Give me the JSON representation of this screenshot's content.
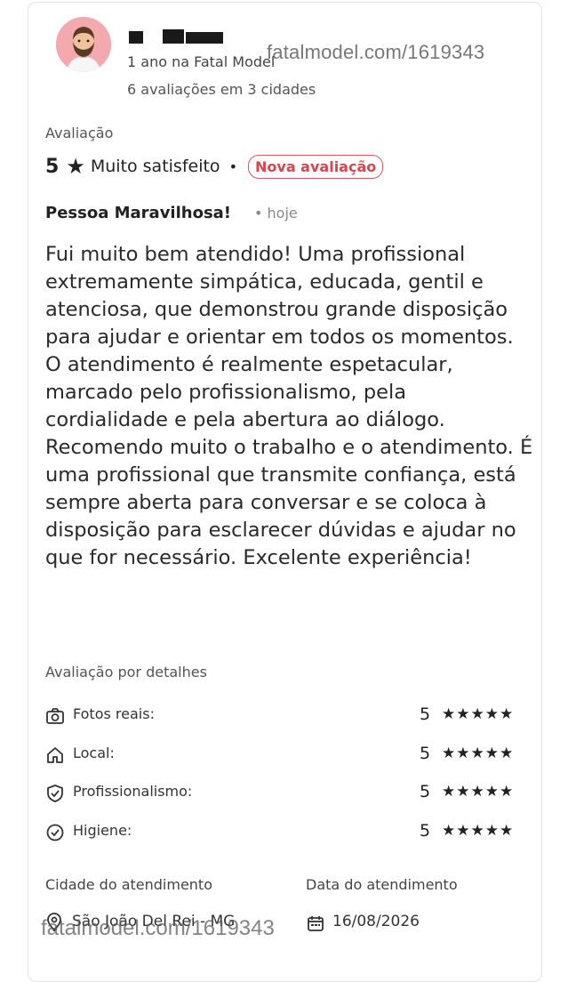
{
  "header": {
    "member_since": "1 ano na Fatal Model",
    "reviews_count": "6 avaliações em 3 cidades",
    "watermark": "fatalmodel.com/1619343"
  },
  "rating": {
    "section_label": "Avaliação",
    "score": "5",
    "label": "Muito satisfeito",
    "separator": "•",
    "badge": "Nova avaliação"
  },
  "review": {
    "title": "Pessoa Maravilhosa!",
    "date": "• hoje",
    "body": "Fui muito bem atendido! Uma profissional extremamente simpática, educada, gentil e atenciosa, que demonstrou grande disposição para ajudar e orientar em todos os momentos. O atendimento é realmente espetacular, marcado pelo profissionalismo, pela cordialidade e pela abertura ao diálogo.\nRecomendo muito o trabalho e o atendimento. É uma profissional que transmite confiança, está sempre aberta para conversar e se coloca à disposição para esclarecer dúvidas e ajudar no que for necessário. Excelente experiência!"
  },
  "details": {
    "section_label": "Avaliação por detalhes",
    "items": [
      {
        "label": "Fotos reais:",
        "score": "5",
        "stars": "★★★★★",
        "icon": "camera-icon"
      },
      {
        "label": "Local:",
        "score": "5",
        "stars": "★★★★★",
        "icon": "home-icon"
      },
      {
        "label": "Profissionalismo:",
        "score": "5",
        "stars": "★★★★★",
        "icon": "shield-check-icon"
      },
      {
        "label": "Higiene:",
        "score": "5",
        "stars": "★★★★★",
        "icon": "check-circle-icon"
      }
    ]
  },
  "footer": {
    "city_label": "Cidade do atendimento",
    "city_value": "São João Del Rei - MG",
    "date_label": "Data do atendimento",
    "date_value": "16/08/2026",
    "watermark": "fatalmodel.com/1619343"
  }
}
